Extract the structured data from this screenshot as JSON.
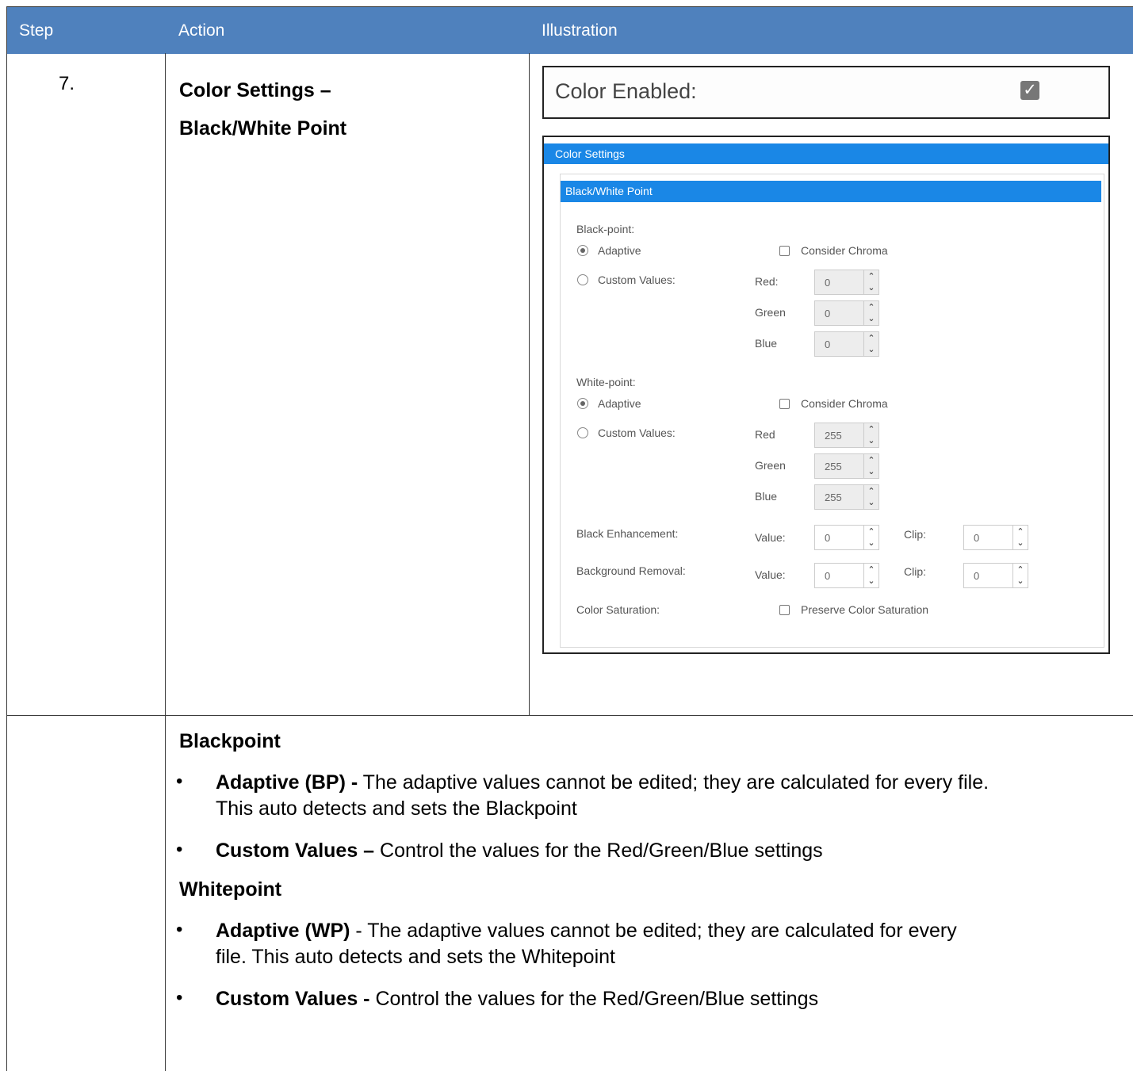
{
  "table": {
    "headers": {
      "step": "Step",
      "action": "Action",
      "illustration": "Illustration"
    },
    "row1": {
      "step": "7.",
      "title_line1": "Color Settings –",
      "title_line2": "Black/White Point"
    }
  },
  "illustration": {
    "color_enabled_label": "Color Enabled:",
    "color_enabled_checked": true,
    "color_settings_title": "Color Settings",
    "bw_title": "Black/White Point",
    "black_point": {
      "label": "Black-point:",
      "adaptive_label": "Adaptive",
      "consider_chroma_label": "Consider Chroma",
      "custom_values_label": "Custom Values:",
      "red_label": "Red:",
      "green_label": "Green",
      "blue_label": "Blue",
      "red_value": "0",
      "green_value": "0",
      "blue_value": "0"
    },
    "white_point": {
      "label": "White-point:",
      "adaptive_label": "Adaptive",
      "consider_chroma_label": "Consider Chroma",
      "custom_values_label": "Custom Values:",
      "red_label": "Red",
      "green_label": "Green",
      "blue_label": "Blue",
      "red_value": "255",
      "green_value": "255",
      "blue_value": "255"
    },
    "black_enhancement": {
      "label": "Black Enhancement:",
      "value_label": "Value:",
      "value": "0",
      "clip_label": "Clip:",
      "clip": "0"
    },
    "background_removal": {
      "label": "Background Removal:",
      "value_label": "Value:",
      "value": "0",
      "clip_label": "Clip:",
      "clip": "0"
    },
    "color_saturation": {
      "label": "Color Saturation:",
      "preserve_label": "Preserve Color Saturation"
    }
  },
  "description": {
    "blackpoint_title": "Blackpoint",
    "bp_adaptive_term": "Adaptive (BP) -",
    "bp_adaptive_text1": " The adaptive values cannot be edited; they are calculated for every file.",
    "bp_adaptive_text2": "This auto detects and sets the Blackpoint",
    "bp_custom_term": "Custom Values –",
    "bp_custom_text": " Control the values for the Red/Green/Blue settings",
    "whitepoint_title": "Whitepoint",
    "wp_adaptive_term": "Adaptive (WP)",
    "wp_adaptive_text1": " - The adaptive values cannot be edited; they are calculated for every",
    "wp_adaptive_text2": "file. This auto detects and sets the Whitepoint",
    "wp_custom_term": "Custom Values -",
    "wp_custom_text": " Control the values for the Red/Green/Blue settings"
  }
}
